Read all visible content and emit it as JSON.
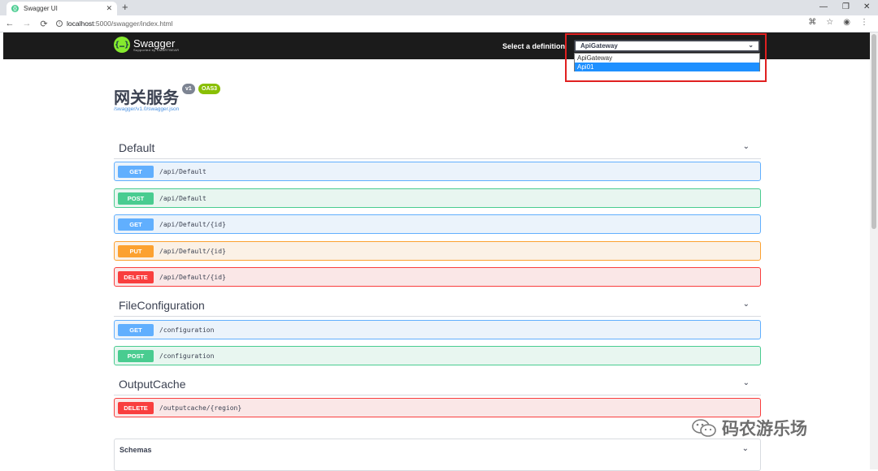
{
  "browser": {
    "tab_title": "Swagger UI",
    "tab_favicon": "swagger-favicon",
    "url_host": "localhost",
    "url_rest": ":5000/swagger/index.html",
    "new_tab": "+",
    "window_controls": [
      "—",
      "❐",
      "✕"
    ]
  },
  "topbar": {
    "logo_name": "Swagger",
    "logo_sub": "Supported by SMARTBEAR",
    "definition_label": "Select a definition",
    "selected_definition": "ApiGateway",
    "options": [
      "ApiGateway",
      "Api01"
    ],
    "highlighted_option": "Api01"
  },
  "info": {
    "title": "网关服务",
    "version": "v1",
    "oas": "OAS3",
    "url": "/swagger/v1.0/swagger.json"
  },
  "sections": [
    {
      "name": "Default",
      "ops": [
        {
          "method": "GET",
          "path": "/api/Default"
        },
        {
          "method": "POST",
          "path": "/api/Default"
        },
        {
          "method": "GET",
          "path": "/api/Default/{id}"
        },
        {
          "method": "PUT",
          "path": "/api/Default/{id}"
        },
        {
          "method": "DELETE",
          "path": "/api/Default/{id}"
        }
      ]
    },
    {
      "name": "FileConfiguration",
      "ops": [
        {
          "method": "GET",
          "path": "/configuration"
        },
        {
          "method": "POST",
          "path": "/configuration"
        }
      ]
    },
    {
      "name": "OutputCache",
      "ops": [
        {
          "method": "DELETE",
          "path": "/outputcache/{region}"
        }
      ]
    }
  ],
  "schemas_label": "Schemas",
  "watermark": "码农游乐场",
  "colors": {
    "get": "#61affe",
    "post": "#49cc90",
    "put": "#fca130",
    "delete": "#f93e3e",
    "topbar": "#1b1b1b",
    "highlight": "#e02020"
  }
}
